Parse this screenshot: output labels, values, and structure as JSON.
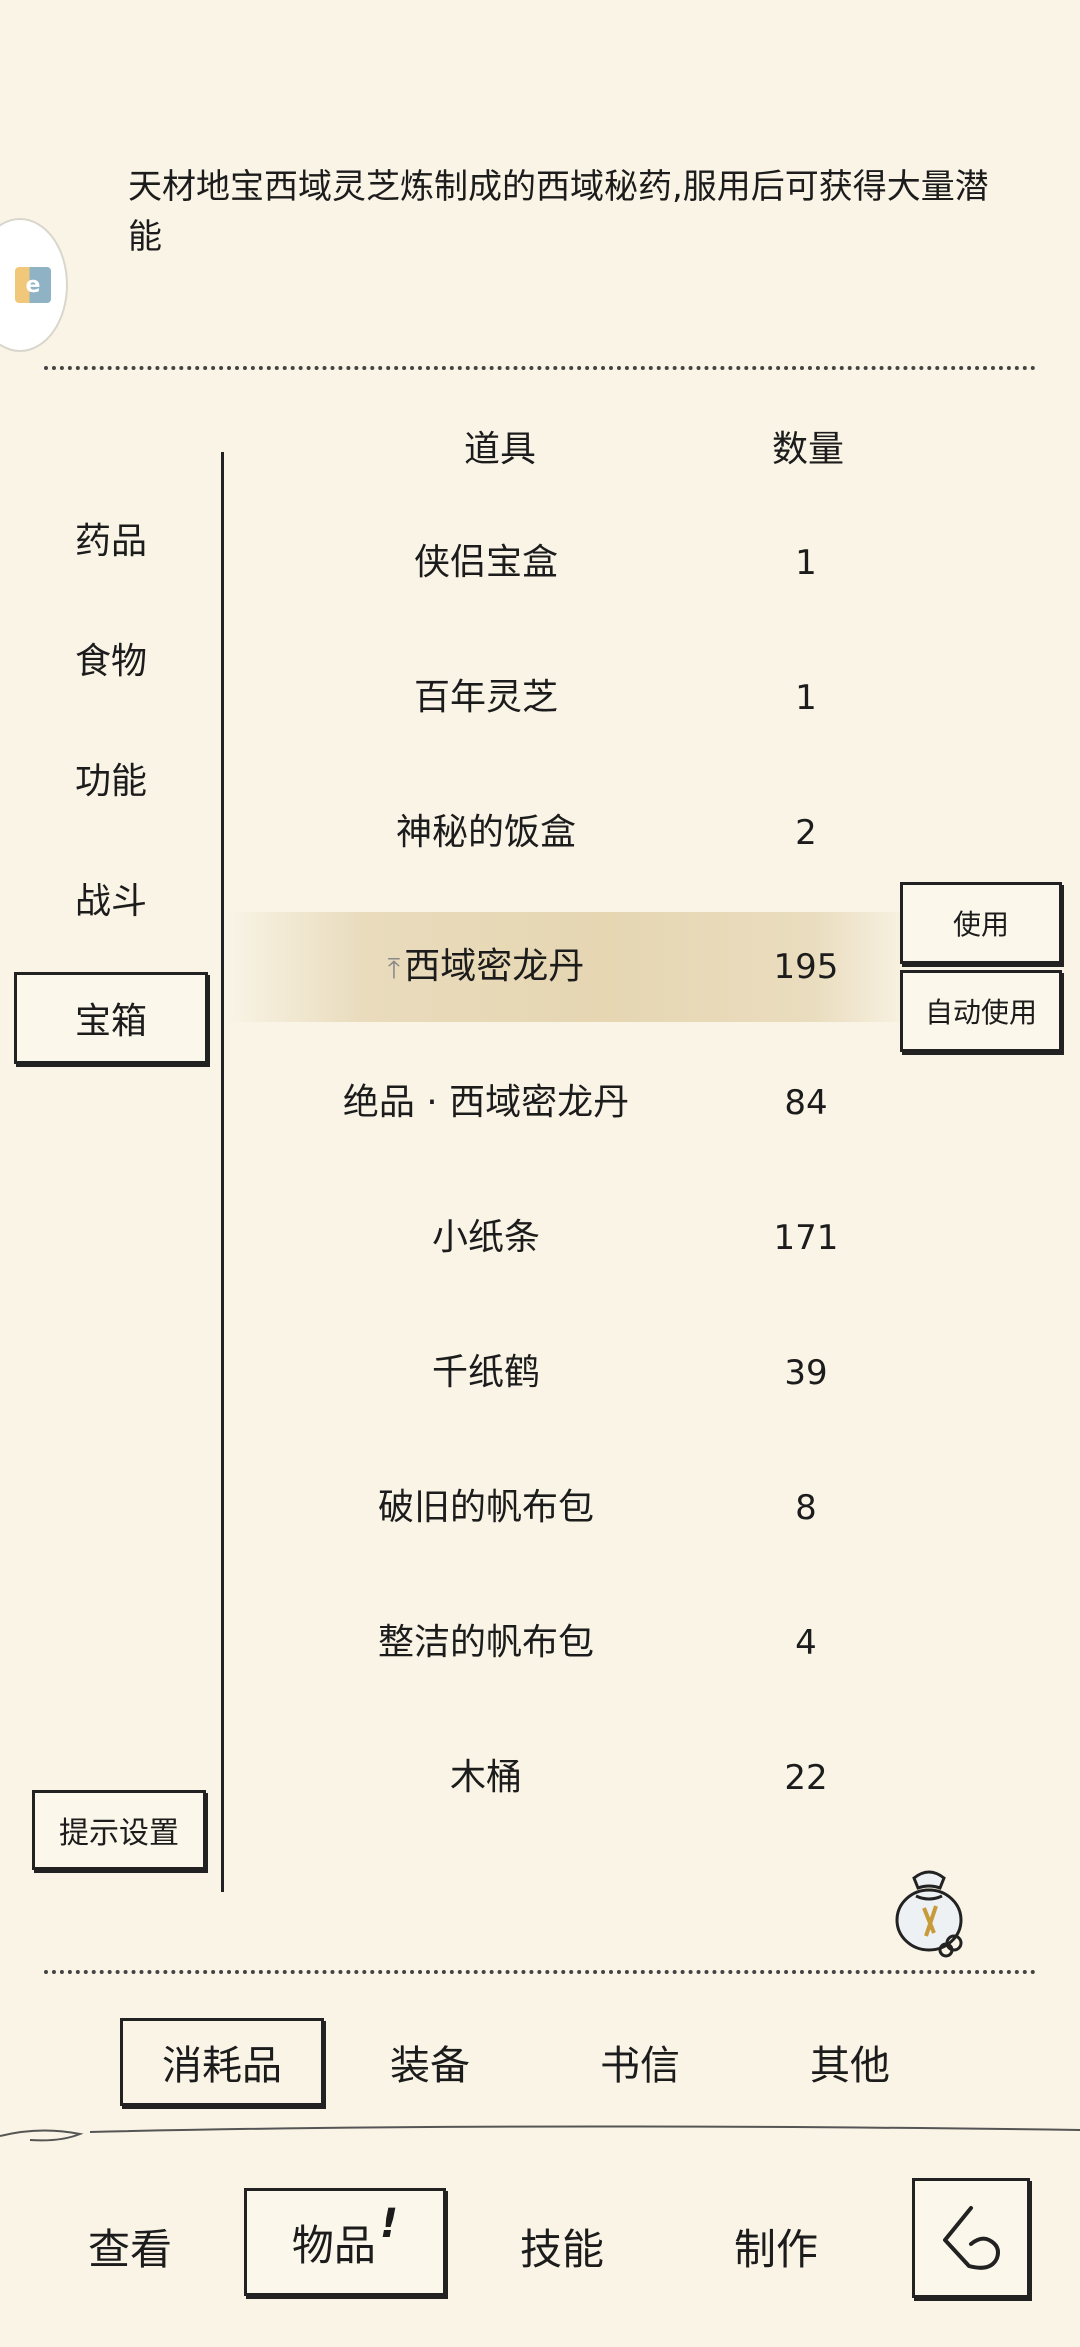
{
  "description": "天材地宝西域灵芝炼制成的西域秘药,服用后可获得大量潜能",
  "categories": [
    {
      "label": "药品"
    },
    {
      "label": "食物"
    },
    {
      "label": "功能"
    },
    {
      "label": "战斗"
    },
    {
      "label": "宝箱",
      "active": true
    }
  ],
  "hint_button": "提示设置",
  "table": {
    "headers": {
      "item": "道具",
      "qty": "数量"
    },
    "rows": [
      {
        "name": "侠侣宝盒",
        "qty": "1"
      },
      {
        "name": "百年灵芝",
        "qty": "1"
      },
      {
        "name": "神秘的饭盒",
        "qty": "2"
      },
      {
        "name": "西域密龙丹",
        "qty": "195",
        "selected": true,
        "pinned": true
      },
      {
        "name": "绝品 · 西域密龙丹",
        "qty": "84"
      },
      {
        "name": "小纸条",
        "qty": "171"
      },
      {
        "name": "千纸鹤",
        "qty": "39"
      },
      {
        "name": "破旧的帆布包",
        "qty": "8"
      },
      {
        "name": "整洁的帆布包",
        "qty": "4"
      },
      {
        "name": "木桶",
        "qty": "22"
      }
    ]
  },
  "actions": {
    "use": "使用",
    "auto_use": "自动使用"
  },
  "sub_tabs": [
    {
      "label": "消耗品",
      "active": true
    },
    {
      "label": "装备"
    },
    {
      "label": "书信"
    },
    {
      "label": "其他"
    }
  ],
  "nav": {
    "view": "查看",
    "items": "物品",
    "items_badge": "!",
    "skills": "技能",
    "craft": "制作"
  },
  "icons": {
    "side_logo": "app-logo-icon",
    "pin": "pin-top-icon",
    "bag": "loot-bag-icon",
    "back": "back-arrow-icon"
  },
  "colors": {
    "background": "#f9f4e6",
    "ink": "#1c1c1c",
    "highlight": "#e6d6b2"
  }
}
